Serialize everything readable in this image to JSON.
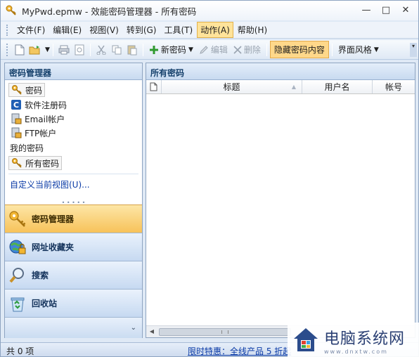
{
  "window": {
    "title": "MyPwd.epmw - 效能密码管理器 - 所有密码",
    "minimize": "—",
    "maximize": "□",
    "close": "✕"
  },
  "menu": {
    "items": [
      "文件(F)",
      "编辑(E)",
      "视图(V)",
      "转到(G)",
      "工具(T)",
      "动作(A)",
      "帮助(H)"
    ],
    "active_index": 5
  },
  "toolbar": {
    "new_password": "新密码",
    "edit": "编辑",
    "delete": "删除",
    "hide_content": "隐藏密码内容",
    "interface_style": "界面风格"
  },
  "left_panel": {
    "header": "密码管理器",
    "items": [
      {
        "label": "密码",
        "icon": "key-icon"
      },
      {
        "label": "软件注册码",
        "icon": "software-c-icon"
      },
      {
        "label": "Email帐户",
        "icon": "email-account-icon"
      },
      {
        "label": "FTP帐户",
        "icon": "ftp-account-icon"
      }
    ],
    "my_passwords_label": "我的密码",
    "all_passwords": "所有密码",
    "customize_view": "自定义当前视图(U)...",
    "nav_buttons": [
      {
        "label": "密码管理器",
        "icon": "key-icon"
      },
      {
        "label": "网址收藏夹",
        "icon": "globe-lock-icon"
      },
      {
        "label": "搜索",
        "icon": "magnifier-icon"
      },
      {
        "label": "回收站",
        "icon": "recycle-bin-icon"
      }
    ]
  },
  "right_panel": {
    "header": "所有密码",
    "columns": [
      "标题",
      "用户名",
      "帐号"
    ]
  },
  "status": {
    "count": "共 0 项",
    "promo": "限时特惠：全线产品 5 折起"
  },
  "watermark": {
    "cn": "电脑系统网",
    "en": "www.dnxtw.com"
  },
  "colors": {
    "accent_orange": "#f7c25a",
    "header_blue": "#15406b",
    "link_blue": "#0a3aa6"
  }
}
